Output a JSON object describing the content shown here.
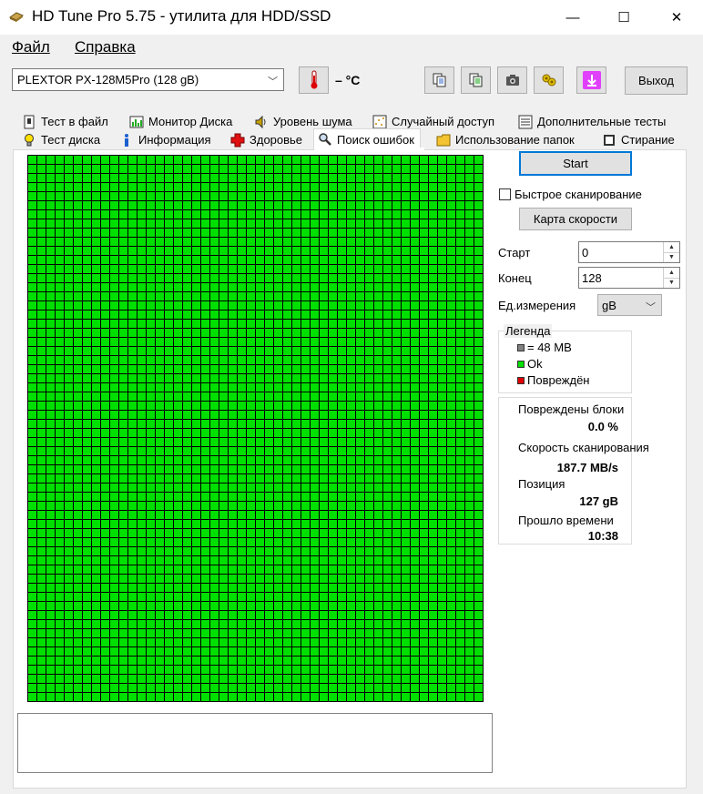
{
  "window": {
    "title": "HD Tune Pro 5.75 - утилита для HDD/SSD",
    "minimize": "—",
    "maximize": "☐",
    "close": "✕"
  },
  "menu": {
    "file": "Файл",
    "help": "Справка"
  },
  "toolbar": {
    "drive": "PLEXTOR PX-128M5Pro (128 gB)",
    "temperature": "– °C",
    "exit_label": "Выход"
  },
  "tabs_row1": [
    {
      "label": "Тест в файл",
      "icon": "file-test-icon"
    },
    {
      "label": "Монитор Диска",
      "icon": "disk-monitor-icon"
    },
    {
      "label": "Уровень шума",
      "icon": "speaker-icon"
    },
    {
      "label": "Случайный доступ",
      "icon": "random-access-icon"
    },
    {
      "label": "Дополнительные  тесты",
      "icon": "extra-tests-icon"
    }
  ],
  "tabs_row2": [
    {
      "label": "Тест диска",
      "icon": "bulb-icon"
    },
    {
      "label": "Информация",
      "icon": "info-icon"
    },
    {
      "label": "Здоровье",
      "icon": "health-cross-icon"
    },
    {
      "label": "Поиск ошибок",
      "icon": "magnifier-icon",
      "active": true
    },
    {
      "label": "Использование папок",
      "icon": "folder-icon"
    },
    {
      "label": "Стирание",
      "icon": "erase-icon"
    }
  ],
  "scan": {
    "start_label": "Start",
    "quick_scan_label": "Быстрое сканирование",
    "quick_scan_checked": false,
    "speed_map_label": "Карта скорости",
    "start_field_label": "Старт",
    "start_value": "0",
    "end_field_label": "Конец",
    "end_value": "128",
    "unit_label": "Ед.измерения",
    "unit_value": "gB"
  },
  "legend": {
    "title": "Легенда",
    "items": [
      {
        "label": "= 48 MB",
        "color": "#808080"
      },
      {
        "label": "Ok",
        "color": "#00e000"
      },
      {
        "label": "Повреждён",
        "color": "#e00000"
      }
    ]
  },
  "stats": {
    "damaged_label": "Повреждены блоки",
    "damaged_value": "0.0 %",
    "speed_label": "Скорость сканирования",
    "speed_value": "187.7 MB/s",
    "position_label": "Позиция",
    "position_value": "127 gB",
    "elapsed_label": "Прошло времени",
    "elapsed_value": "10:38"
  },
  "grid": {
    "ok_color": "#00e000",
    "line_color": "#000000",
    "ok_fraction": 1.0
  },
  "colors": {
    "accent": "#0078d7",
    "exit_icon_bg": "#e040fb"
  }
}
